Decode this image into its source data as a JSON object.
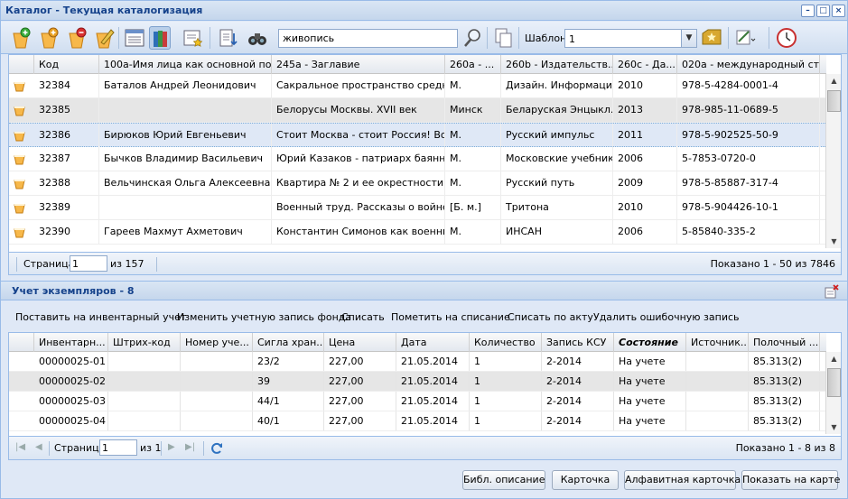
{
  "window": {
    "title": "Каталог - Текущая каталогизация"
  },
  "toolbar": {
    "search_value": "живопись",
    "template_label": "Шаблон:",
    "template_value": "1"
  },
  "catalog": {
    "columns": [
      "Код",
      "100a-Имя лица как основной пои...",
      "245a - Заглавие",
      "260a - ...",
      "260b - Издательств...",
      "260c - Да...",
      "020a - международный ст..."
    ],
    "rows": [
      {
        "code": "32384",
        "author": "Баталов Андрей Леонидович",
        "title": "Сакральное пространство средн...",
        "place": "М.",
        "publisher": "Дизайн. Информаци...",
        "year": "2010",
        "isbn": "978-5-4284-0001-4"
      },
      {
        "code": "32385",
        "author": "",
        "title": "Белорусы Москвы. XVII век",
        "place": "Минск",
        "publisher": "Беларуская Энцыкл...",
        "year": "2013",
        "isbn": "978-985-11-0689-5"
      },
      {
        "code": "32386",
        "author": "Бирюков Юрий Евгеньевич",
        "title": "Стоит Москва - стоит Россия! Во...",
        "place": "М.",
        "publisher": "Русский импульс",
        "year": "2011",
        "isbn": "978-5-902525-50-9"
      },
      {
        "code": "32387",
        "author": "Бычков Владимир Васильевич",
        "title": "Юрий Казаков - патриарх баянног...",
        "place": "М.",
        "publisher": "Московские учебники",
        "year": "2006",
        "isbn": "5-7853-0720-0"
      },
      {
        "code": "32388",
        "author": "Вельчинская Ольга Алексеевна",
        "title": "Квартира № 2 и ее окрестности. ...",
        "place": "М.",
        "publisher": "Русский путь",
        "year": "2009",
        "isbn": "978-5-85887-317-4"
      },
      {
        "code": "32389",
        "author": "",
        "title": "Военный труд. Рассказы о войне",
        "place": "[Б. м.]",
        "publisher": "Тритона",
        "year": "2010",
        "isbn": "978-5-904426-10-1"
      },
      {
        "code": "32390",
        "author": "Гареев Махмут Ахметович",
        "title": "Константин Симонов как военны...",
        "place": "М.",
        "publisher": "ИНСАН",
        "year": "2006",
        "isbn": "5-85840-335-2"
      }
    ],
    "pager": {
      "page_label": "Страница",
      "page_value": "1",
      "of_label": "из 157",
      "shown": "Показано 1 - 50 из 7846"
    }
  },
  "copies": {
    "title": "Учет экземпляров - 8",
    "actions": [
      "Поставить на инвентарный учет",
      "Изменить учетную запись фонда",
      "Списать",
      "Пометить на списание",
      "Списать по акту",
      "Удалить ошибочную запись"
    ],
    "columns": [
      "Инвентарн...",
      "Штрих-код",
      "Номер уче...",
      "Сигла хран...",
      "Цена",
      "Дата",
      "Количество",
      "Запись КСУ",
      "Состояние",
      "Источник...",
      "Полочный ..."
    ],
    "rows": [
      {
        "inv": "00000025-01",
        "barcode": "",
        "num": "",
        "sigla": "23/2",
        "price": "227,00",
        "date": "21.05.2014",
        "qty": "1",
        "ksu": "2-2014",
        "state": "На учете",
        "source": "",
        "shelf": "85.313(2)"
      },
      {
        "inv": "00000025-02",
        "barcode": "",
        "num": "",
        "sigla": "39",
        "price": "227,00",
        "date": "21.05.2014",
        "qty": "1",
        "ksu": "2-2014",
        "state": "На учете",
        "source": "",
        "shelf": "85.313(2)"
      },
      {
        "inv": "00000025-03",
        "barcode": "",
        "num": "",
        "sigla": "44/1",
        "price": "227,00",
        "date": "21.05.2014",
        "qty": "1",
        "ksu": "2-2014",
        "state": "На учете",
        "source": "",
        "shelf": "85.313(2)"
      },
      {
        "inv": "00000025-04",
        "barcode": "",
        "num": "",
        "sigla": "40/1",
        "price": "227,00",
        "date": "21.05.2014",
        "qty": "1",
        "ksu": "2-2014",
        "state": "На учете",
        "source": "",
        "shelf": "85.313(2)"
      }
    ],
    "pager": {
      "page_label": "Страница",
      "page_value": "1",
      "of_label": "из 1",
      "shown": "Показано 1 - 8 из 8"
    }
  },
  "buttons": {
    "bibl": "Библ. описание",
    "card": "Карточка",
    "alpha_card": "Алфавитная карточка",
    "map": "Показать на карте"
  },
  "colors": {
    "title_text": "#15428b",
    "border": "#99bbe8",
    "panel_bg": "#dfe8f6",
    "selected_row": "#dfe8f6"
  }
}
